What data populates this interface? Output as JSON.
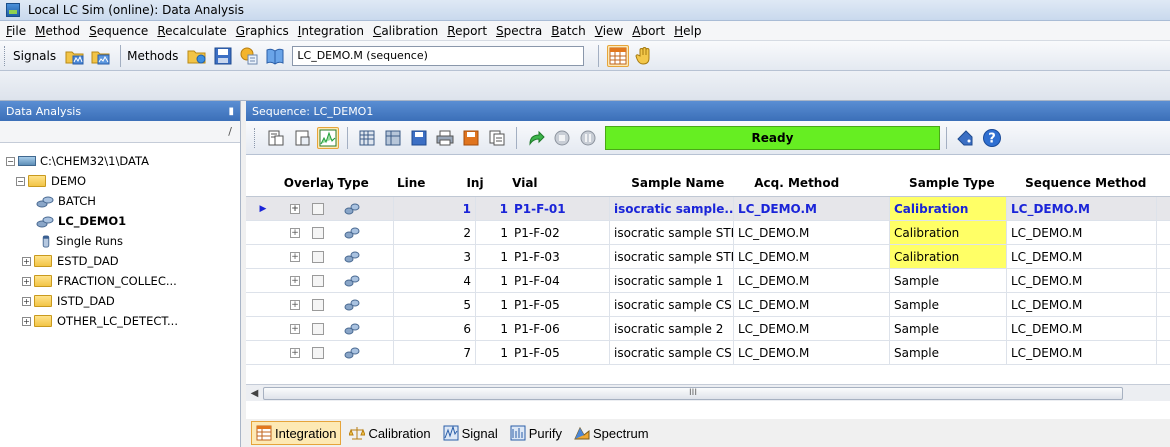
{
  "window": {
    "title": "Local LC Sim (online): Data Analysis"
  },
  "menu": [
    "File",
    "Method",
    "Sequence",
    "Recalculate",
    "Graphics",
    "Integration",
    "Calibration",
    "Report",
    "Spectra",
    "Batch",
    "View",
    "Abort",
    "Help"
  ],
  "toolbar": {
    "signals_label": "Signals",
    "methods_label": "Methods",
    "method_value": "LC_DEMO.M (sequence)"
  },
  "left_panel": {
    "title": "Data Analysis",
    "pin": "ᵖ",
    "path_sep": "/",
    "tree": {
      "root": "C:\\CHEM32\\1\\DATA",
      "demo": "DEMO",
      "batch": "BATCH",
      "lc_demo01": "LC_DEMO1",
      "single_runs": "Single Runs",
      "estd_dad": "ESTD_DAD",
      "fraction": "FRACTION_COLLEC...",
      "istd_dad": "ISTD_DAD",
      "other": "OTHER_LC_DETECT..."
    }
  },
  "sequence": {
    "title": "Sequence: LC_DEMO1",
    "status": "Ready",
    "status_color": "#66ee22",
    "columns": {
      "overlay": "Overlay",
      "type": "Type",
      "line": "Line",
      "inj": "Inj",
      "vial": "Vial",
      "sample_name": "Sample Name",
      "acq_method": "Acq. Method",
      "sample_type": "Sample Type",
      "sequence_method": "Sequence Method"
    },
    "rows": [
      {
        "line": "1",
        "inj": "1",
        "vial": "P1-F-01",
        "sample_name": "isocratic sample...",
        "acq_method": "LC_DEMO.M",
        "sample_type": "Calibration",
        "sequence_method": "LC_DEMO.M"
      },
      {
        "line": "2",
        "inj": "1",
        "vial": "P1-F-02",
        "sample_name": "isocratic sample STD",
        "acq_method": "LC_DEMO.M",
        "sample_type": "Calibration",
        "sequence_method": "LC_DEMO.M"
      },
      {
        "line": "3",
        "inj": "1",
        "vial": "P1-F-03",
        "sample_name": "isocratic sample  STD",
        "acq_method": "LC_DEMO.M",
        "sample_type": "Calibration",
        "sequence_method": "LC_DEMO.M"
      },
      {
        "line": "4",
        "inj": "1",
        "vial": "P1-F-04",
        "sample_name": "isocratic sample 1",
        "acq_method": "LC_DEMO.M",
        "sample_type": "Sample",
        "sequence_method": "LC_DEMO.M"
      },
      {
        "line": "5",
        "inj": "1",
        "vial": "P1-F-05",
        "sample_name": "isocratic sample CS",
        "acq_method": "LC_DEMO.M",
        "sample_type": "Sample",
        "sequence_method": "LC_DEMO.M"
      },
      {
        "line": "6",
        "inj": "1",
        "vial": "P1-F-06",
        "sample_name": "isocratic sample 2",
        "acq_method": "LC_DEMO.M",
        "sample_type": "Sample",
        "sequence_method": "LC_DEMO.M"
      },
      {
        "line": "7",
        "inj": "1",
        "vial": "P1-F-05",
        "sample_name": "isocratic sample CS",
        "acq_method": "LC_DEMO.M",
        "sample_type": "Sample",
        "sequence_method": "LC_DEMO.M"
      }
    ],
    "calibration_color": "#ffff66",
    "selected_color": "#1a24d8",
    "scroll_grip": "III"
  },
  "bottom_tabs": {
    "integration": "Integration",
    "calibration": "Calibration",
    "signal": "Signal",
    "purify": "Purify",
    "spectrum": "Spectrum"
  }
}
